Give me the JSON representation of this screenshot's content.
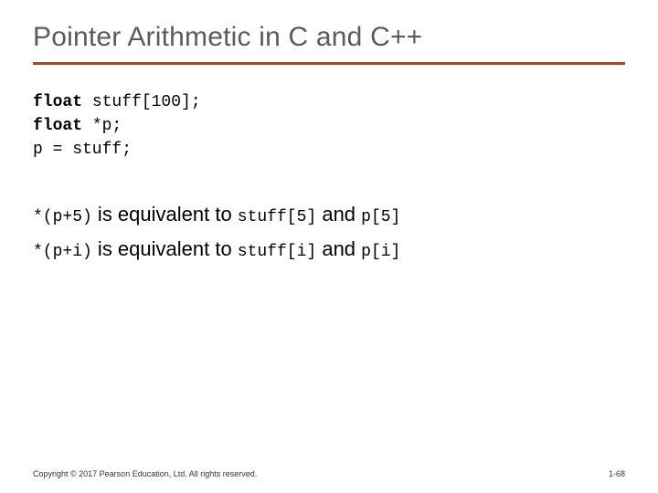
{
  "title": "Pointer Arithmetic in C and C++",
  "code": {
    "kw1": "float",
    "l1_rest": " stuff[100];",
    "kw2": "float",
    "l2_rest": " *p;",
    "l3": "p = stuff;"
  },
  "eq": [
    {
      "lhs": "*(p+5)",
      "mid": " is equivalent to ",
      "r1": "stuff[5]",
      "and": " and ",
      "r2": "p[5]"
    },
    {
      "lhs": "*(p+i)",
      "mid": " is equivalent to ",
      "r1": "stuff[i]",
      "and": " and ",
      "r2": "p[i]"
    }
  ],
  "footer": {
    "copyright": "Copyright © 2017 Pearson Education, Ltd. All rights reserved.",
    "page": "1-68"
  }
}
